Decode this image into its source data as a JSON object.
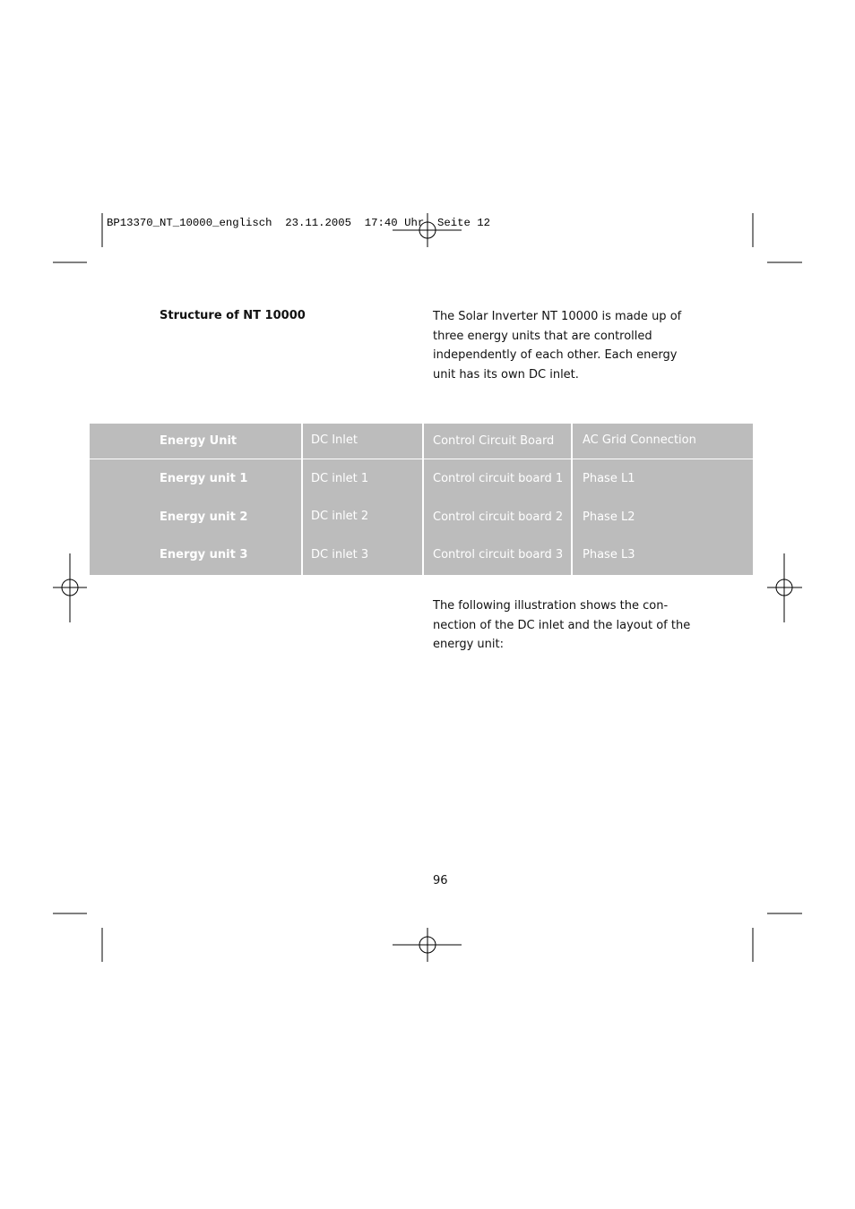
{
  "slug": "BP13370_NT_10000_englisch  23.11.2005  17:40 Uhr  Seite 12",
  "heading": "Structure of NT 10000",
  "intro": "The Solar Inverter NT 10000 is made up of three energy units that are controlled independently of each other. Each energy unit has its own DC inlet.",
  "table": {
    "headers": [
      "Energy Unit",
      "DC Inlet",
      "Control Circuit Board",
      "AC Grid Connection"
    ],
    "rows": [
      [
        "Energy unit 1",
        "DC inlet 1",
        "Control circuit board 1",
        "Phase L1"
      ],
      [
        "Energy unit 2",
        "DC inlet 2",
        "Control circuit board 2",
        "Phase L2"
      ],
      [
        "Energy unit 3",
        "DC inlet 3",
        "Control circuit board 3",
        "Phase L3"
      ]
    ],
    "background_color": "#bcbcbc"
  },
  "illustration_text": "The following illustration shows the con- nection of the DC inlet and the layout of the energy unit:",
  "page_number": "96"
}
